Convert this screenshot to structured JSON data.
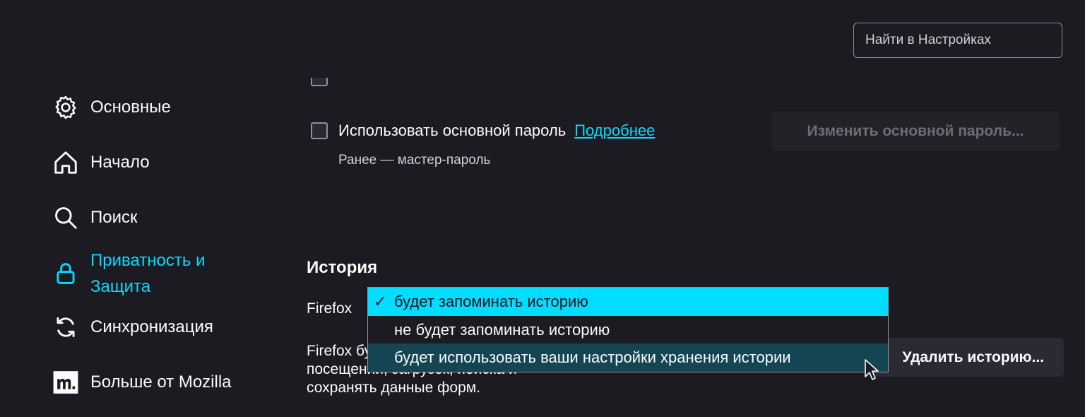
{
  "search": {
    "placeholder": "Найти в Настройках"
  },
  "sidebar": {
    "items": [
      {
        "label": "Основные"
      },
      {
        "label": "Начало"
      },
      {
        "label": "Поиск"
      },
      {
        "label": "Приватность и Защита"
      },
      {
        "label": "Синхронизация"
      },
      {
        "label": "Больше от Mozilla"
      }
    ]
  },
  "passwords": {
    "use_primary_label": "Использовать основной пароль",
    "learn_more": "Подробнее",
    "hint": "Ранее — мастер-пароль",
    "change_button": "Изменить основной пароль..."
  },
  "history": {
    "title": "История",
    "firefox_label": "Firefox",
    "description": "Firefox будет помнить историю посещений, загрузок, поиска и сохранять данные форм.",
    "clear_button": "Удалить историю...",
    "dropdown": {
      "options": [
        {
          "label": "будет запоминать историю"
        },
        {
          "label": "не будет запоминать историю"
        },
        {
          "label": "будет использовать ваши настройки хранения истории"
        }
      ],
      "check_glyph": "✓"
    }
  },
  "colors": {
    "accent": "#00ddff",
    "background": "#1c1b22",
    "hover": "#134553"
  }
}
